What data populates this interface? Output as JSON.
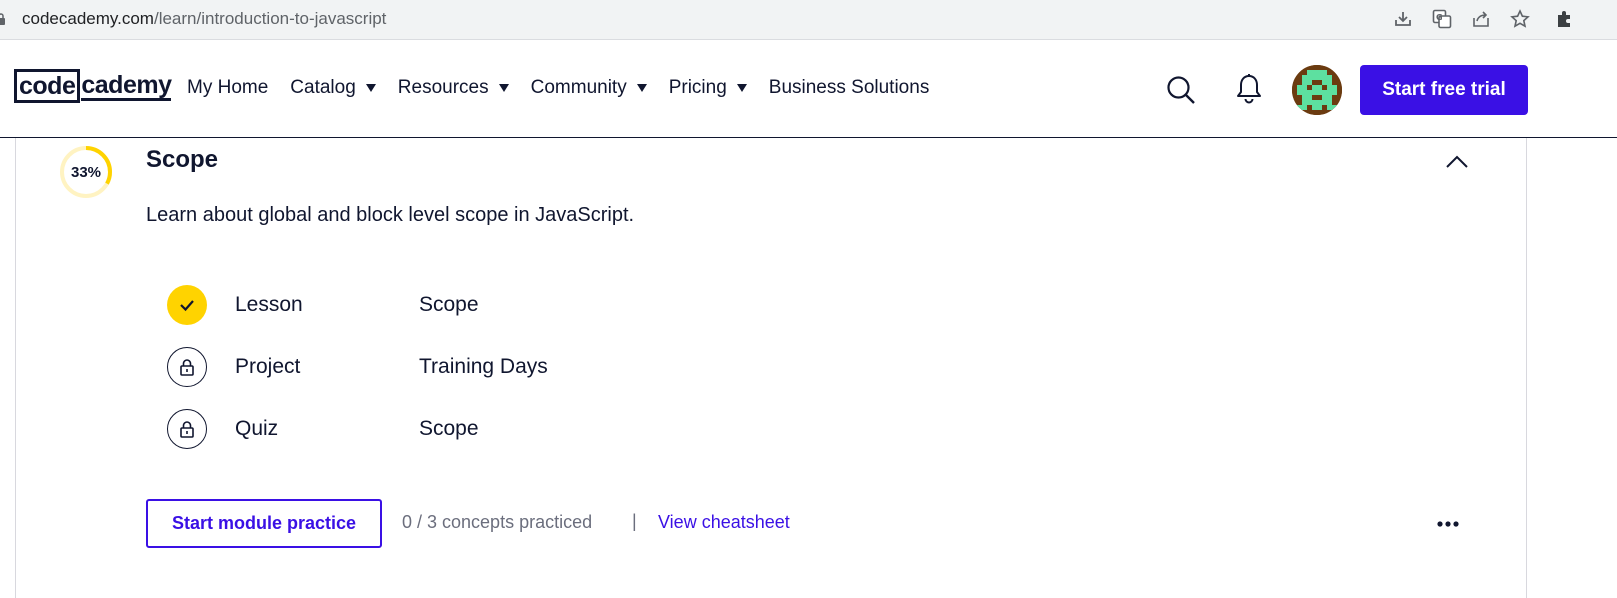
{
  "browser": {
    "url_domain": "codecademy.com",
    "url_path": "/learn/introduction-to-javascript",
    "icons": [
      "download-icon",
      "translate-icon",
      "share-icon",
      "bookmark-star-icon",
      "extensions-icon"
    ]
  },
  "header": {
    "logo_box": "code",
    "logo_rest": "cademy",
    "nav": [
      {
        "label": "My Home",
        "dropdown": false
      },
      {
        "label": "Catalog",
        "dropdown": true
      },
      {
        "label": "Resources",
        "dropdown": true
      },
      {
        "label": "Community",
        "dropdown": true
      },
      {
        "label": "Pricing",
        "dropdown": true
      },
      {
        "label": "Business Solutions",
        "dropdown": false
      }
    ],
    "cta_label": "Start free trial"
  },
  "module": {
    "progress_label": "33%",
    "progress_value": 0.33,
    "title": "Scope",
    "description": "Learn about global and block level scope in JavaScript.",
    "items": [
      {
        "type": "Lesson",
        "name": "Scope",
        "status": "complete"
      },
      {
        "type": "Project",
        "name": "Training Days",
        "status": "locked"
      },
      {
        "type": "Quiz",
        "name": "Scope",
        "status": "locked"
      }
    ],
    "practice_button": "Start module practice",
    "concepts_text": "0 / 3 concepts practiced",
    "separator": "|",
    "cheatsheet_link": "View cheatsheet"
  },
  "colors": {
    "brand_blue": "#3a10e5",
    "ink": "#10162f",
    "progress_yellow": "#ffd300",
    "progress_track": "#fff3c2"
  }
}
